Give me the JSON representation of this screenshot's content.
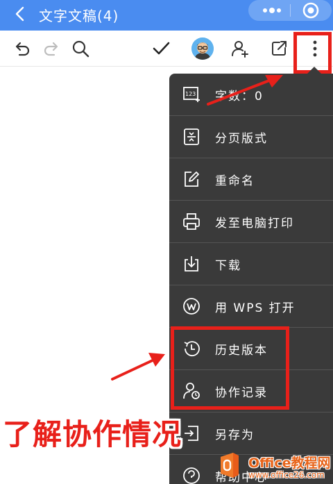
{
  "titlebar": {
    "title": "文字文稿(4)",
    "back_icon": "chevron-left-icon",
    "more_icon": "more-dots-icon",
    "close_icon": "target-circle-icon",
    "color": "#4a8cf0"
  },
  "toolbar": {
    "undo_icon": "undo-icon",
    "redo_icon": "redo-icon",
    "search_icon": "search-icon",
    "done_icon": "checkmark-icon",
    "avatar_icon": "avatar-icon",
    "add_collaborator_icon": "add-user-icon",
    "share_icon": "share-icon",
    "menu_icon": "vertical-dots-icon"
  },
  "menu": {
    "items": [
      {
        "label": "字数：0",
        "icon": "word-count-icon"
      },
      {
        "label": "分页版式",
        "icon": "page-layout-icon"
      },
      {
        "label": "重命名",
        "icon": "rename-icon"
      },
      {
        "label": "发至电脑打印",
        "icon": "printer-icon"
      },
      {
        "label": "下载",
        "icon": "download-icon"
      },
      {
        "label": "用 WPS 打开",
        "icon": "wps-logo-icon"
      },
      {
        "label": "历史版本",
        "icon": "history-icon"
      },
      {
        "label": "协作记录",
        "icon": "collaboration-record-icon"
      },
      {
        "label": "另存为",
        "icon": "save-as-icon"
      },
      {
        "label": "帮助中心",
        "icon": "help-icon"
      }
    ],
    "background": "#3a3a3a"
  },
  "annotation": {
    "caption": "了解协作情况",
    "color": "#e8201a"
  },
  "watermark": {
    "brand": "Office教程网",
    "url": "www.office26.com"
  }
}
